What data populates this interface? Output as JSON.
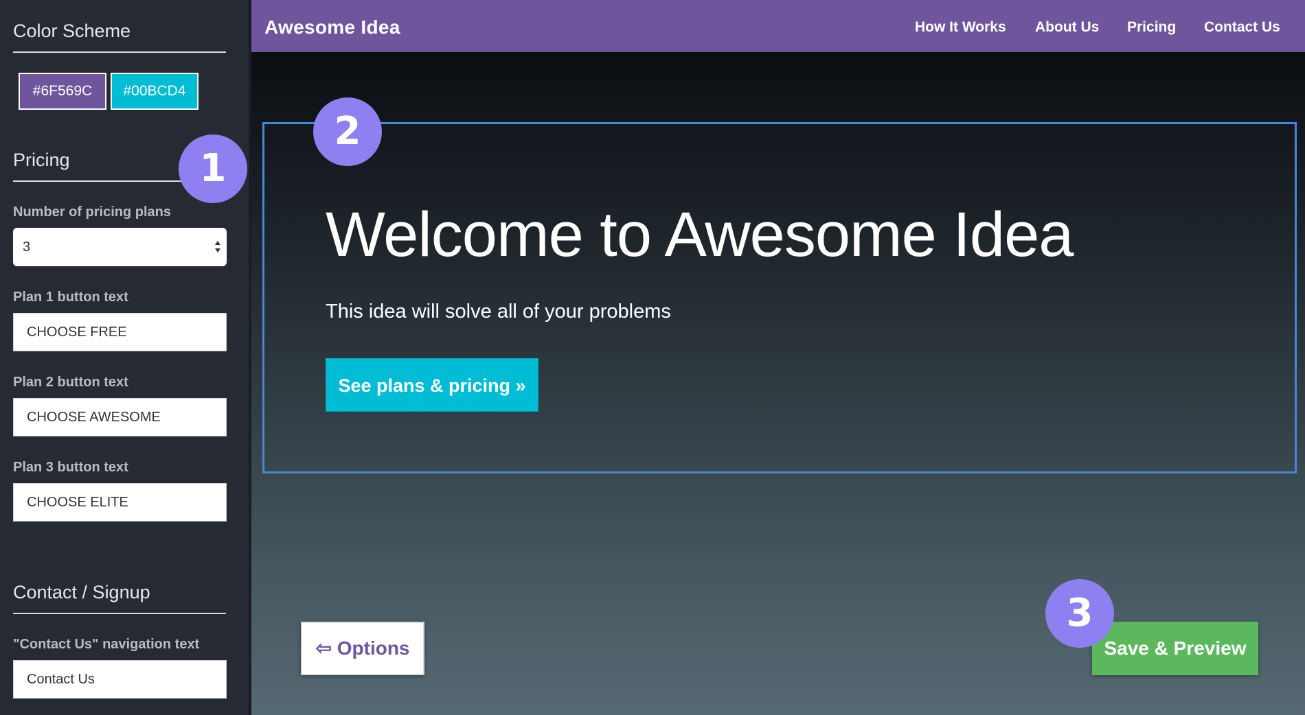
{
  "sidebar": {
    "color_scheme": {
      "title": "Color Scheme",
      "primary": "#6F569C",
      "secondary": "#00BCD4"
    },
    "pricing": {
      "title": "Pricing",
      "plans_label": "Number of pricing plans",
      "plans_value": "3",
      "plan1_label": "Plan 1 button text",
      "plan1_value": "CHOOSE FREE",
      "plan2_label": "Plan 2 button text",
      "plan2_value": "CHOOSE AWESOME",
      "plan3_label": "Plan 3 button text",
      "plan3_value": "CHOOSE ELITE"
    },
    "contact": {
      "title": "Contact / Signup",
      "nav_label": "\"Contact Us\" navigation text",
      "nav_value": "Contact Us"
    }
  },
  "navbar": {
    "brand": "Awesome Idea",
    "links": [
      "How It Works",
      "About Us",
      "Pricing",
      "Contact Us"
    ]
  },
  "hero": {
    "title": "Welcome to Awesome Idea",
    "subtitle": "This idea will solve all of your problems",
    "cta": "See plans & pricing »"
  },
  "footer": {
    "options": "Options",
    "options_icon": "arrow-left-icon",
    "save": "Save & Preview"
  },
  "badges": [
    "1",
    "2",
    "3"
  ],
  "colors": {
    "purple": "#6F569C",
    "cyan": "#00BCD4",
    "green": "#5CB85C",
    "badge": "#8E80F0",
    "frame": "#4A86D8"
  }
}
